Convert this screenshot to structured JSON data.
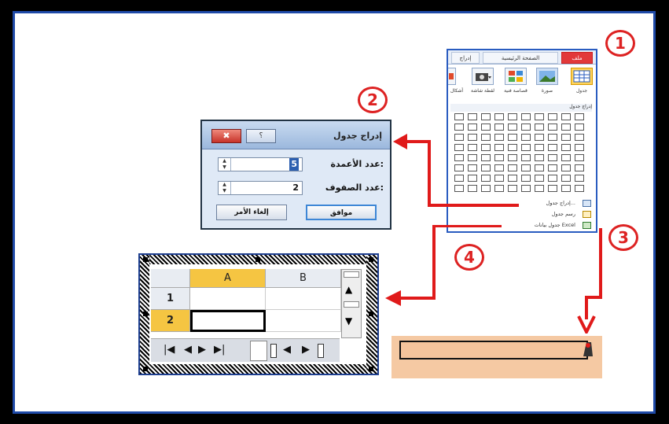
{
  "ribbon": {
    "tabs": [
      "إدراج",
      "الصفحة الرئيسية",
      "ملف"
    ],
    "groups": [
      "جدول",
      "صورة",
      "قصاصة فنية",
      "لقطة شاشة",
      "أشكال"
    ],
    "insert_table_header": "إدراج جدول",
    "menu_items": [
      "إدراج جدول...",
      "رسم جدول",
      "جدول بيانات Excel"
    ]
  },
  "steps": [
    "1",
    "2",
    "3",
    "4"
  ],
  "dialog": {
    "title": "إدراج جدول",
    "close_glyph": "✖",
    "help_glyph": "؟",
    "columns_label": "عدد الأعمدة:",
    "columns_value": "5",
    "rows_label": "عدد الصفوف:",
    "rows_value": "2",
    "ok_label": "موافق",
    "cancel_label": "إلغاء الأمر"
  },
  "sheet": {
    "columns": [
      "A",
      "B"
    ],
    "rows": [
      "1",
      "2"
    ],
    "selected_row": "2",
    "selected_column": "A"
  },
  "colors": {
    "accent_red": "#e01a1a",
    "frame_blue": "#1f4aa8",
    "selected_header": "#f5c542",
    "text_field_bg": "#f5c9a3"
  }
}
